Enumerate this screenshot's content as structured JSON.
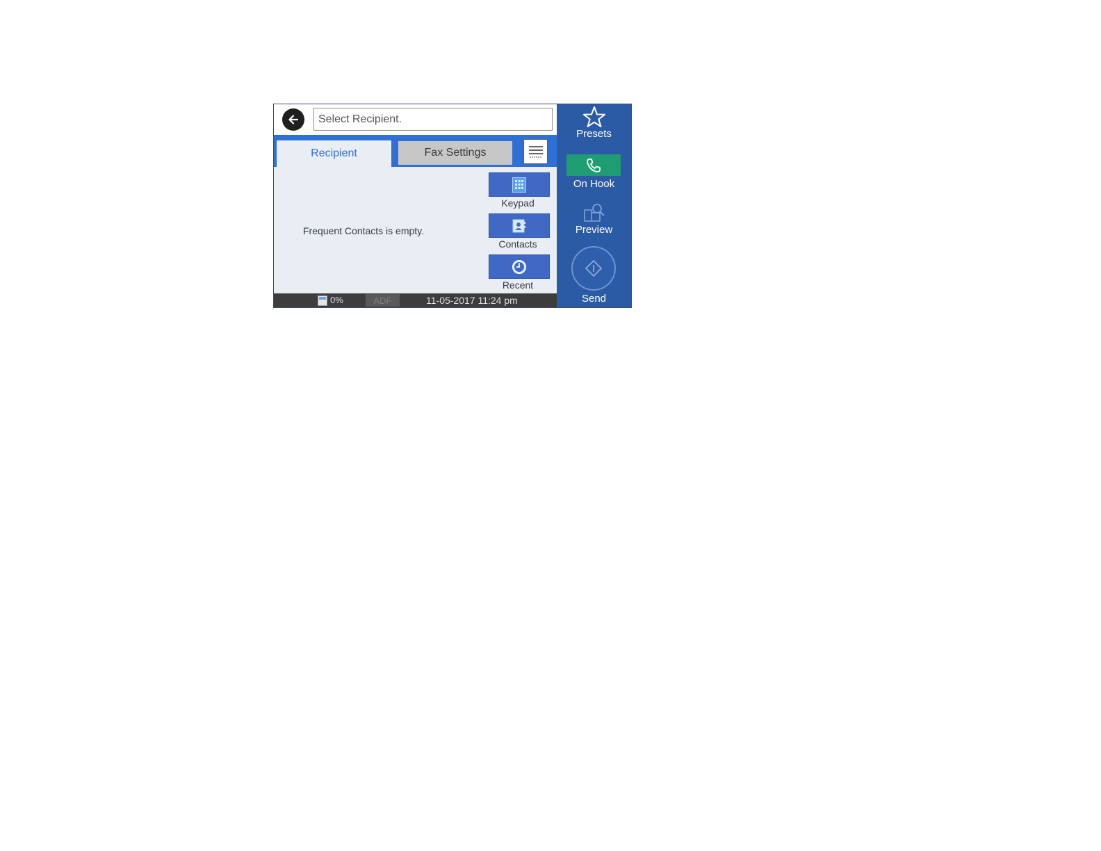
{
  "header": {
    "recipient_placeholder": "Select Recipient."
  },
  "tabs": [
    {
      "label": "Recipient",
      "active": true
    },
    {
      "label": "Fax Settings",
      "active": false
    }
  ],
  "content": {
    "empty_message": "Frequent Contacts is empty."
  },
  "side_buttons": {
    "keypad": "Keypad",
    "contacts": "Contacts",
    "recent": "Recent"
  },
  "status_bar": {
    "ink_level": "0%",
    "adf": "ADF",
    "datetime": "11-05-2017 11:24 pm"
  },
  "right_column": {
    "presets": "Presets",
    "on_hook": "On Hook",
    "preview": "Preview",
    "send": "Send"
  },
  "colors": {
    "accent_blue": "#2c5ba6",
    "tab_blue": "#2f6fd6",
    "on_hook_green": "#1f9d72"
  },
  "icons": {
    "back": "arrow-left-icon",
    "menu": "list-menu-icon",
    "keypad": "keypad-icon",
    "contacts": "contacts-icon",
    "recent": "clock-icon",
    "presets": "star-icon",
    "on_hook": "phone-icon",
    "preview": "preview-icon",
    "send": "diamond-start-icon"
  }
}
